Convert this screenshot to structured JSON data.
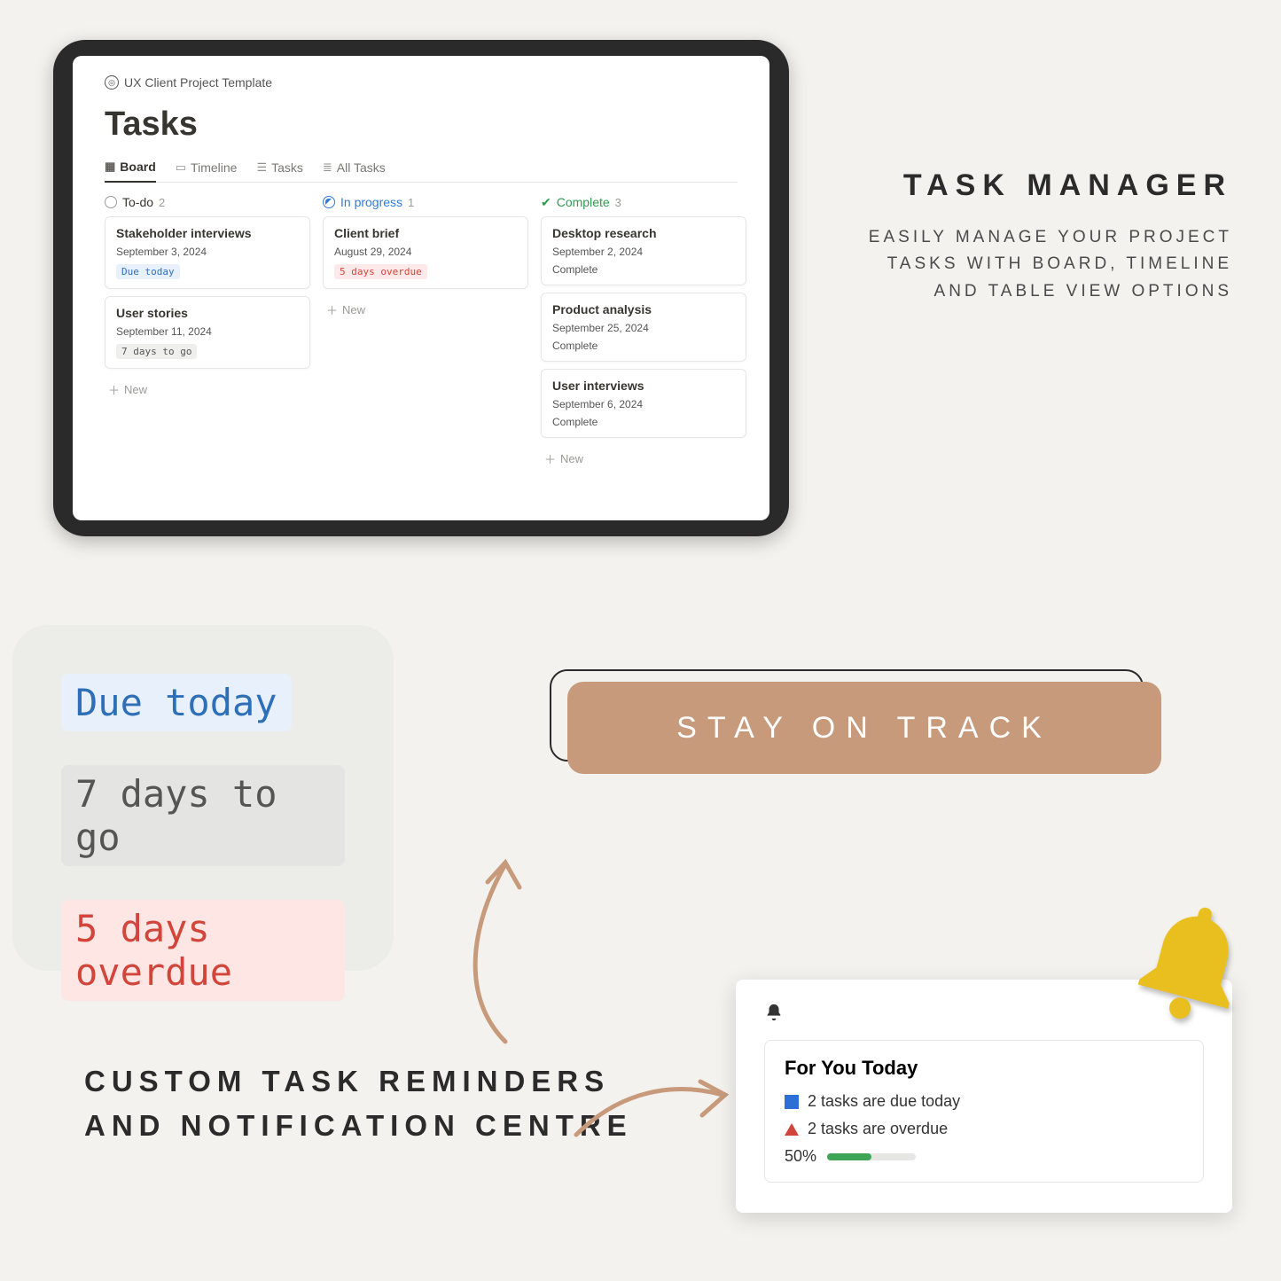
{
  "breadcrumb": "UX Client Project Template",
  "page_title": "Tasks",
  "tabs": [
    {
      "icon": "board",
      "label": "Board",
      "active": true
    },
    {
      "icon": "timeline",
      "label": "Timeline",
      "active": false
    },
    {
      "icon": "tasks",
      "label": "Tasks",
      "active": false
    },
    {
      "icon": "list",
      "label": "All Tasks",
      "active": false
    }
  ],
  "columns": [
    {
      "status": "todo",
      "label": "To-do",
      "count": 2,
      "cards": [
        {
          "title": "Stakeholder interviews",
          "date": "September 3, 2024",
          "pill": {
            "text": "Due today",
            "type": "due"
          }
        },
        {
          "title": "User stories",
          "date": "September 11, 2024",
          "pill": {
            "text": "7 days to go",
            "type": "days"
          }
        }
      ]
    },
    {
      "status": "progress",
      "label": "In progress",
      "count": 1,
      "cards": [
        {
          "title": "Client brief",
          "date": "August 29, 2024",
          "pill": {
            "text": "5 days overdue",
            "type": "over"
          }
        }
      ]
    },
    {
      "status": "complete",
      "label": "Complete",
      "count": 3,
      "cards": [
        {
          "title": "Desktop research",
          "date": "September 2, 2024",
          "status_text": "Complete"
        },
        {
          "title": "Product analysis",
          "date": "September 25, 2024",
          "status_text": "Complete"
        },
        {
          "title": "User interviews",
          "date": "September 6, 2024",
          "status_text": "Complete"
        }
      ]
    }
  ],
  "new_label": "New",
  "promo": {
    "title": "TASK MANAGER",
    "subtitle": "EASILY MANAGE YOUR PROJECT TASKS WITH BOARD, TIMELINE AND TABLE VIEW OPTIONS"
  },
  "pills_showcase": [
    {
      "text": "Due today",
      "type": "due"
    },
    {
      "text": "7 days to go",
      "type": "days"
    },
    {
      "text": "5 days overdue",
      "type": "over"
    }
  ],
  "cta_label": "STAY ON TRACK",
  "feature_caption": "CUSTOM TASK REMINDERS AND NOTIFICATION CENTRE",
  "notification": {
    "title": "For You Today",
    "rows": [
      {
        "icon": "square-blue",
        "text": "2 tasks are due today"
      },
      {
        "icon": "triangle-red",
        "text": "2 tasks are overdue"
      }
    ],
    "progress": {
      "label": "50%",
      "value": 50
    }
  }
}
